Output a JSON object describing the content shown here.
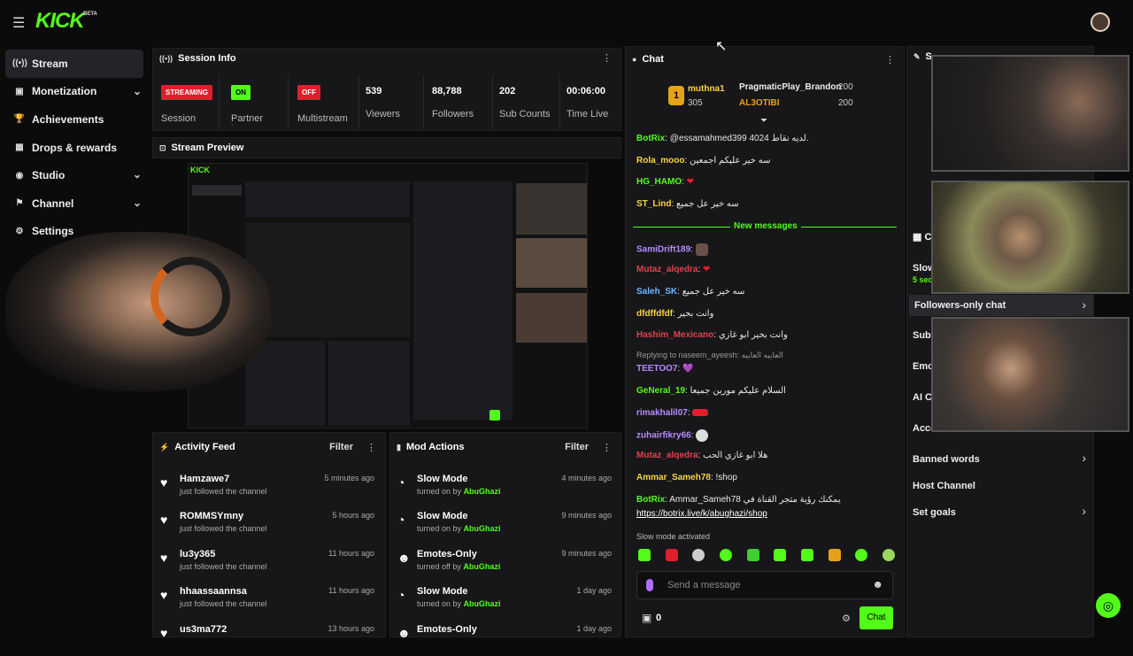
{
  "header": {
    "logo": "KICK",
    "beta": "BETA"
  },
  "sidebar": {
    "items": [
      {
        "label": "Stream",
        "icon": "broadcast-icon"
      },
      {
        "label": "Monetization",
        "icon": "dollar-icon"
      },
      {
        "label": "Achievements",
        "icon": "trophy-icon"
      },
      {
        "label": "Drops & rewards",
        "icon": "gift-icon"
      },
      {
        "label": "Studio",
        "icon": "studio-icon"
      },
      {
        "label": "Channel",
        "icon": "channel-icon"
      },
      {
        "label": "Settings",
        "icon": "gear-icon"
      }
    ]
  },
  "session": {
    "title": "Session Info",
    "streaming_badge": "STREAMING",
    "session_label": "Session",
    "partner_badge": "ON",
    "partner_label": "Partner Income",
    "multistream_badge": "OFF",
    "multistream_label": "Multistream",
    "viewers": "539",
    "viewers_label": "Viewers",
    "followers": "88,788",
    "followers_label": "Followers",
    "subs": "202",
    "subs_label": "Sub Counts",
    "time": "00:06:00",
    "time_label": "Time Live"
  },
  "preview": {
    "title": "Stream Preview"
  },
  "activity": {
    "title": "Activity Feed",
    "filter": "Filter",
    "rows": [
      {
        "name": "Hamzawe7",
        "sub": "just followed the channel",
        "time": "5 minutes ago"
      },
      {
        "name": "ROMMSYmny",
        "sub": "just followed the channel",
        "time": "5 hours ago"
      },
      {
        "name": "lu3y365",
        "sub": "just followed the channel",
        "time": "11 hours ago"
      },
      {
        "name": "hhaassaannsa",
        "sub": "just followed the channel",
        "time": "11 hours ago"
      },
      {
        "name": "us3ma772",
        "sub": "",
        "time": "13 hours ago"
      }
    ]
  },
  "mod": {
    "title": "Mod Actions",
    "filter": "Filter",
    "rows": [
      {
        "name": "Slow Mode",
        "sub": "turned on by",
        "by": "AbuGhazi",
        "time": "4 minutes ago"
      },
      {
        "name": "Slow Mode",
        "sub": "turned on by",
        "by": "AbuGhazi",
        "time": "9 minutes ago"
      },
      {
        "name": "Emotes-Only",
        "sub": "turned off by",
        "by": "AbuGhazi",
        "time": "9 minutes ago"
      },
      {
        "name": "Slow Mode",
        "sub": "turned on by",
        "by": "AbuGhazi",
        "time": "1 day ago"
      },
      {
        "name": "Emotes-Only",
        "sub": "",
        "by": "",
        "time": "1 day ago"
      }
    ]
  },
  "chat": {
    "title": "Chat",
    "leader1_name": "muthna1",
    "leader1_val": "305",
    "leader2_name": "PragmaticPlay_Brandon",
    "leader2_val": "200",
    "leader3_name": "AL3OTIBI",
    "leader3_val": "200",
    "leader_rank": "1",
    "messages": [
      {
        "user": "BotRix",
        "text": "@essamahmed399 4024 لديه نقاط.",
        "color": "#53fc18"
      },
      {
        "user": "Rola_mooo",
        "text": "سه خير عليكم اجمعين",
        "color": "#f5d442"
      },
      {
        "user": "HG_HAMO",
        "text": "❤",
        "color": "#53fc18"
      },
      {
        "user": "ST_Lind",
        "text": "سه خير عل جميع",
        "color": "#f5d442"
      }
    ],
    "new_messages": "New messages",
    "messages2": [
      {
        "user": "SamiDrift189",
        "text": "",
        "color": "#b58cff"
      },
      {
        "user": "Mutaz_alqedra",
        "text": "❤",
        "color": "#e0414c"
      },
      {
        "user": "Saleh_SK",
        "text": "سه خير عل جميع",
        "color": "#6fb7ff"
      },
      {
        "user": "dfdffdfdf",
        "text": "وانت بخير",
        "color": "#f5d442"
      },
      {
        "user": "Hashim_Mexicano",
        "text": "وانت بخير ابو غازي",
        "color": "#e0414c"
      }
    ],
    "reply_note": "Replying to naseem_ayeesh: العايبه العايبه",
    "messages3": [
      {
        "user": "TEETOO7",
        "text": "💜",
        "color": "#b58cff"
      },
      {
        "user": "GeNeral_19",
        "text": "السلام عليكم مورين جميعا",
        "color": "#53fc18"
      },
      {
        "user": "rimakhalil07",
        "text": "",
        "color": "#b58cff"
      },
      {
        "user": "zuhairfikry66",
        "text": "",
        "color": "#b58cff"
      },
      {
        "user": "Mutaz_alqedra",
        "text": "هلا ابو غازي الحب",
        "color": "#e0414c"
      },
      {
        "user": "Ammar_Sameh78",
        "text": "!shop",
        "color": "#f5d442"
      },
      {
        "user": "BotRix",
        "text": "Ammar_Sameh78 يمكنك رؤية متجر القناة في",
        "color": "#53fc18"
      }
    ],
    "link": "https://botrix.live/k/abughazi/shop",
    "slow_note": "Slow mode activated",
    "input_placeholder": "Send a message",
    "points": "0",
    "send_label": "Chat"
  },
  "right": {
    "title_s": "S",
    "title_c": "C",
    "items": [
      {
        "label": "Slow",
        "sub": "5 sec"
      },
      {
        "label": "Followers-only chat"
      },
      {
        "label": "Subs"
      },
      {
        "label": "Emo"
      },
      {
        "label": "AI Ch"
      },
      {
        "label": "Acco"
      },
      {
        "label": "Banned words"
      },
      {
        "label": "Host Channel"
      },
      {
        "label": "Set goals"
      }
    ]
  },
  "colors": {
    "accent": "#53fc18",
    "bg": "#0b0b0c",
    "panel": "#17171a",
    "red": "#e01e2c"
  }
}
